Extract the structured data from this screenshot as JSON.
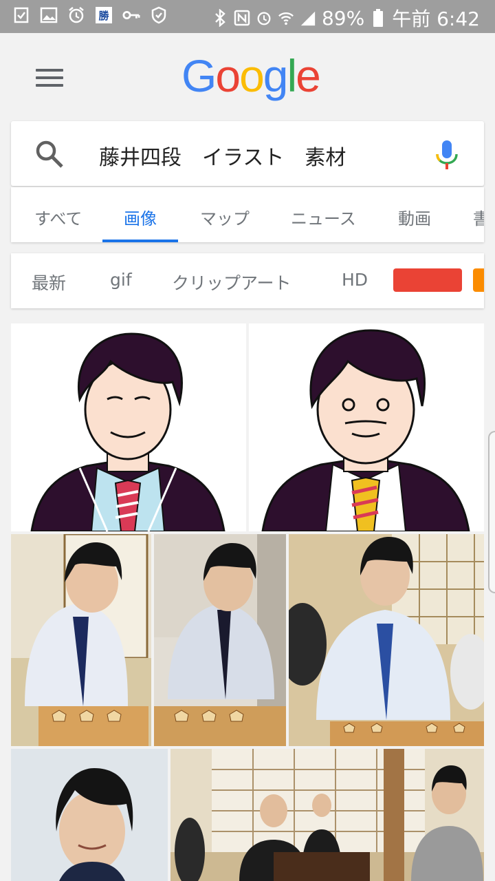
{
  "status_bar": {
    "left_icons": [
      "checklist-icon",
      "gallery-icon",
      "alarm-icon",
      "app-shogi-icon",
      "key-icon",
      "shield-icon"
    ],
    "app_badge_text": "勝",
    "battery": "89%",
    "time": "午前 6:42"
  },
  "header": {
    "logo_letters": [
      {
        "ch": "G",
        "color": "#4285f4"
      },
      {
        "ch": "o",
        "color": "#ea4335"
      },
      {
        "ch": "o",
        "color": "#fbbc05"
      },
      {
        "ch": "g",
        "color": "#4285f4"
      },
      {
        "ch": "l",
        "color": "#34a853"
      },
      {
        "ch": "e",
        "color": "#ea4335"
      }
    ]
  },
  "search": {
    "query": "藤井四段　イラスト　素材"
  },
  "tabs": [
    {
      "label": "すべて",
      "active": false
    },
    {
      "label": "画像",
      "active": true
    },
    {
      "label": "マップ",
      "active": false
    },
    {
      "label": "ニュース",
      "active": false
    },
    {
      "label": "動画",
      "active": false
    },
    {
      "label": "書",
      "active": false
    }
  ],
  "chips": [
    {
      "label": "最新"
    },
    {
      "label": "gif"
    },
    {
      "label": "クリップアート"
    },
    {
      "label": "HD"
    }
  ],
  "colors": {
    "accent_blue": "#1a73e8",
    "chip_red": "#ea4335",
    "chip_orange": "#fb8c00"
  },
  "results": [
    {
      "kind": "illustration",
      "subject": "young-player-cartoon"
    },
    {
      "kind": "illustration",
      "subject": "older-man-cartoon"
    },
    {
      "kind": "photo",
      "subject": "player-at-shogi-board"
    },
    {
      "kind": "photo",
      "subject": "player-moving-piece"
    },
    {
      "kind": "photo",
      "subject": "player-in-tournament-room"
    },
    {
      "kind": "photo",
      "subject": "portrait"
    },
    {
      "kind": "photo",
      "subject": "match-room"
    }
  ]
}
